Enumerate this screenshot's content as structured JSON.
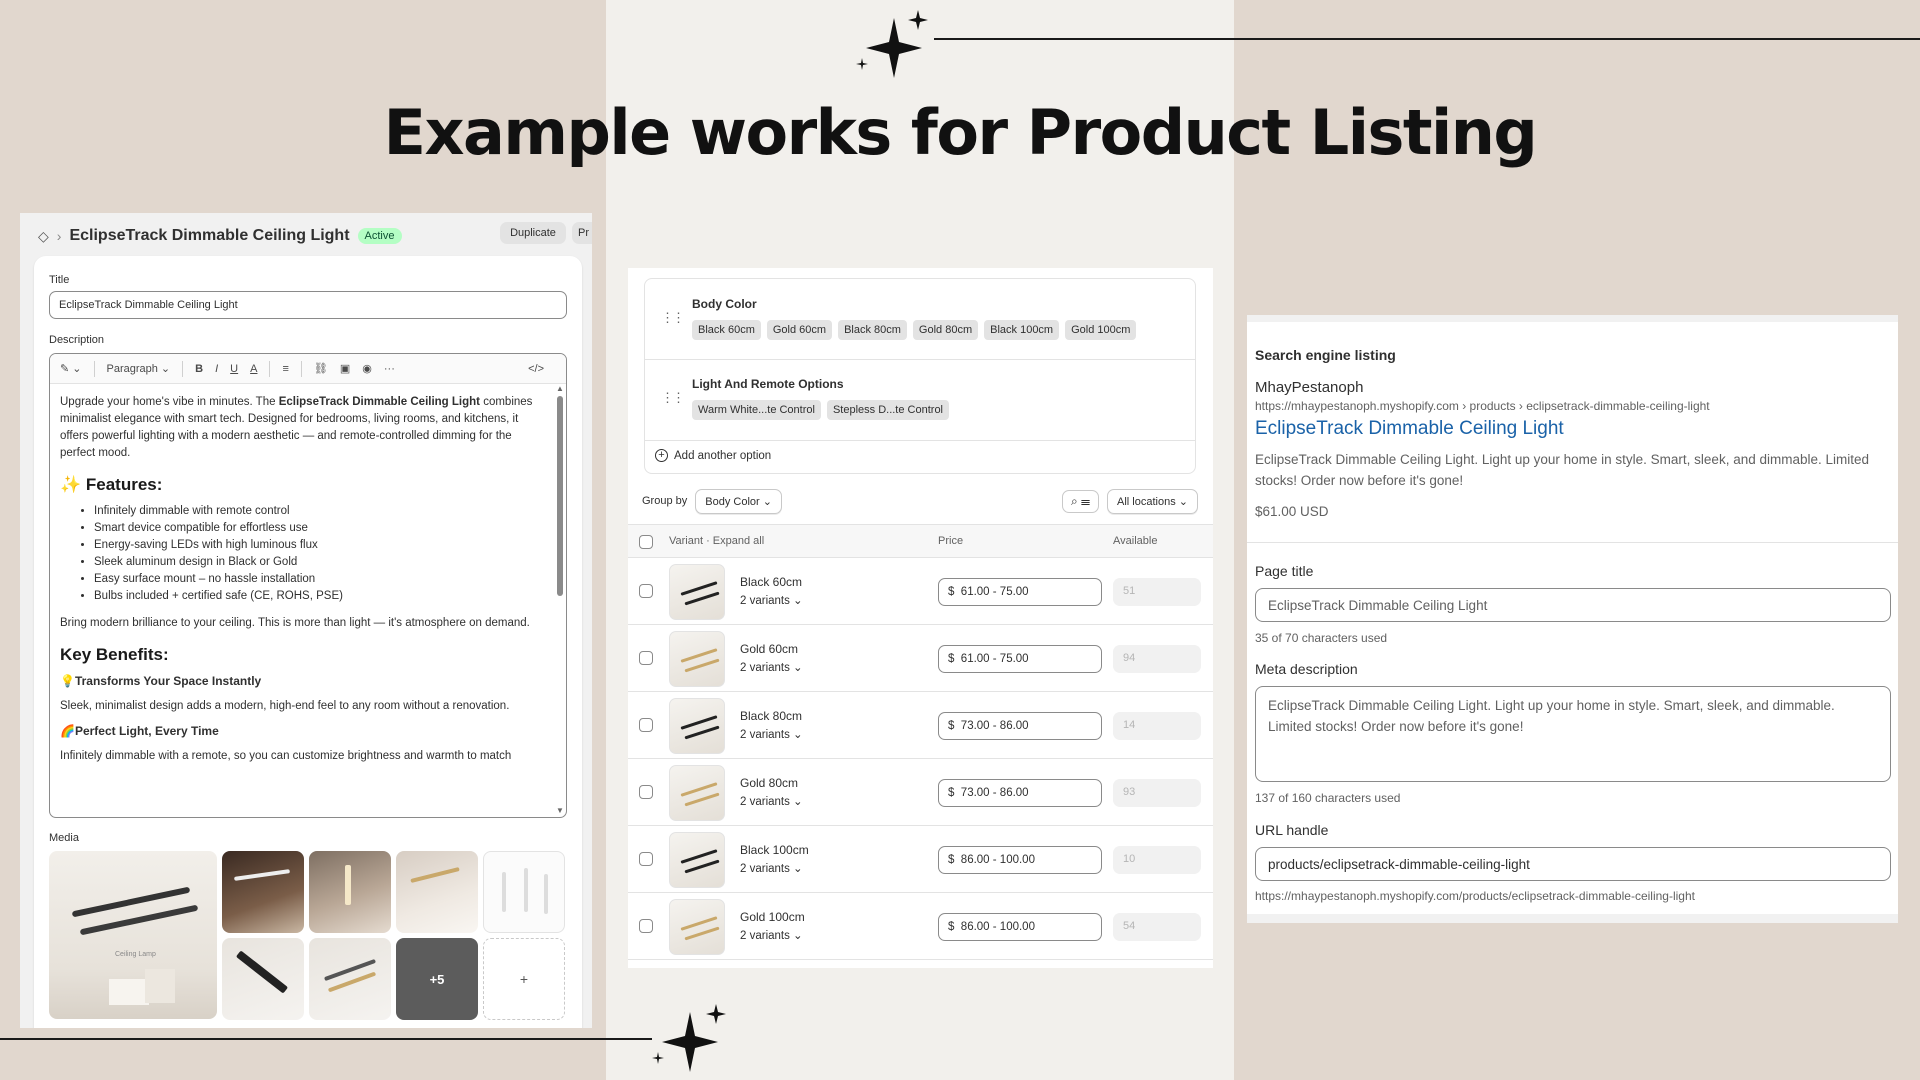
{
  "heading": "Example works for Product Listing",
  "colors": {
    "background": "#e1d7ce",
    "middle_band": "#f2f0ec",
    "active_badge": "#b4fec4",
    "link": "#1a62a8"
  },
  "editor": {
    "breadcrumb_icon": "tag-icon",
    "product_title": "EclipseTrack Dimmable Ceiling Light",
    "status": "Active",
    "duplicate_label": "Duplicate",
    "more_label": "Pr",
    "title_label": "Title",
    "title_value": "EclipseTrack Dimmable Ceiling Light",
    "description_label": "Description",
    "toolbar": {
      "format": "Paragraph",
      "bold": "B",
      "italic": "I",
      "underline": "U",
      "color": "A",
      "align": "≡",
      "more": "···",
      "code": "</>"
    },
    "body": {
      "intro_before": "Upgrade your home's vibe in minutes. The ",
      "intro_bold": "EclipseTrack Dimmable Ceiling Light",
      "intro_after": " combines minimalist elegance with smart tech. Designed for bedrooms, living rooms, and kitchens, it offers powerful lighting with a modern aesthetic — and remote-controlled dimming for the perfect mood.",
      "features_heading": "✨ Features:",
      "features": [
        "Infinitely dimmable with remote control",
        "Smart device compatible for effortless use",
        "Energy-saving LEDs with high luminous flux",
        "Sleek aluminum design in Black or Gold",
        "Easy surface mount – no hassle installation",
        "Bulbs included + certified safe (CE, ROHS, PSE)"
      ],
      "closing": "Bring modern brilliance to your ceiling. This is more than light — it's atmosphere on demand.",
      "benefits_heading": "Key Benefits:",
      "benefit1_title": "💡Transforms Your Space Instantly",
      "benefit1_text": "Sleek, minimalist design adds a modern, high-end feel to any room without a renovation.",
      "benefit2_title": "🌈Perfect Light, Every Time",
      "benefit2_text": "Infinitely dimmable with a remote, so you can customize brightness and warmth to match"
    },
    "media_label": "Media",
    "media_big_caption": "Ceiling Lamp",
    "media_more": "+5",
    "media_add": "+"
  },
  "variants": {
    "options": [
      {
        "name": "Body Color",
        "values": [
          "Black 60cm",
          "Gold 60cm",
          "Black 80cm",
          "Gold 80cm",
          "Black 100cm",
          "Gold 100cm"
        ]
      },
      {
        "name": "Light And Remote Options",
        "values": [
          "Warm White...te Control",
          "Stepless D...te Control"
        ]
      }
    ],
    "add_option": "Add another option",
    "group_by_label": "Group by",
    "group_by_value": "Body Color",
    "locations": "All locations",
    "col_variant": "Variant · Expand all",
    "col_price": "Price",
    "col_available": "Available",
    "rows": [
      {
        "name": "Black 60cm",
        "count": "2 variants",
        "price": "61.00 - 75.00",
        "available": "51"
      },
      {
        "name": "Gold 60cm",
        "count": "2 variants",
        "price": "61.00 - 75.00",
        "available": "94"
      },
      {
        "name": "Black 80cm",
        "count": "2 variants",
        "price": "73.00 - 86.00",
        "available": "14"
      },
      {
        "name": "Gold 80cm",
        "count": "2 variants",
        "price": "73.00 - 86.00",
        "available": "93"
      },
      {
        "name": "Black 100cm",
        "count": "2 variants",
        "price": "86.00 - 100.00",
        "available": "10"
      },
      {
        "name": "Gold 100cm",
        "count": "2 variants",
        "price": "86.00 - 100.00",
        "available": "54"
      }
    ],
    "currency": "$"
  },
  "seo": {
    "heading": "Search engine listing",
    "store": "MhayPestanoph",
    "url": "https://mhaypestanoph.myshopify.com › products › eclipsetrack-dimmable-ceiling-light",
    "link_title": "EclipseTrack Dimmable Ceiling Light",
    "description": "EclipseTrack Dimmable Ceiling Light. Light up your home in style. Smart, sleek, and dimmable. Limited stocks! Order now before it's gone!",
    "price": "$61.00 USD",
    "page_title_label": "Page title",
    "page_title_value": "EclipseTrack Dimmable Ceiling Light",
    "page_title_help": "35 of 70 characters used",
    "meta_label": "Meta description",
    "meta_value": "EclipseTrack Dimmable Ceiling Light. Light up your home in style. Smart, sleek, and dimmable. Limited stocks! Order now before it's gone!",
    "meta_help": "137 of 160 characters used",
    "url_label": "URL handle",
    "url_value": "products/eclipsetrack-dimmable-ceiling-light",
    "url_help": "https://mhaypestanoph.myshopify.com/products/eclipsetrack-dimmable-ceiling-light"
  }
}
